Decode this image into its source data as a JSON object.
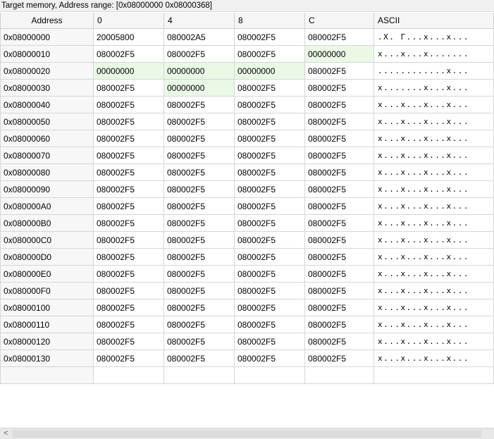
{
  "title": "Target memory, Address range: [0x08000000 0x08000368]",
  "columns": [
    "Address",
    "0",
    "4",
    "8",
    "C",
    "ASCII"
  ],
  "zero_cell_color": "#e9f9e6",
  "rows": [
    {
      "address": "0x08000000",
      "c0": "20005800",
      "c4": "080002A5",
      "c8": "080002F5",
      "cc": "080002F5",
      "ascii": ".X. Г...х...х...",
      "zero": []
    },
    {
      "address": "0x08000010",
      "c0": "080002F5",
      "c4": "080002F5",
      "c8": "080002F5",
      "cc": "00000000",
      "ascii": "х...х...х.......",
      "zero": [
        "cc"
      ]
    },
    {
      "address": "0x08000020",
      "c0": "00000000",
      "c4": "00000000",
      "c8": "00000000",
      "cc": "080002F5",
      "ascii": "............х...",
      "zero": [
        "c0",
        "c4",
        "c8"
      ]
    },
    {
      "address": "0x08000030",
      "c0": "080002F5",
      "c4": "00000000",
      "c8": "080002F5",
      "cc": "080002F5",
      "ascii": "х.......х...х...",
      "zero": [
        "c4"
      ]
    },
    {
      "address": "0x08000040",
      "c0": "080002F5",
      "c4": "080002F5",
      "c8": "080002F5",
      "cc": "080002F5",
      "ascii": "х...х...х...х...",
      "zero": []
    },
    {
      "address": "0x08000050",
      "c0": "080002F5",
      "c4": "080002F5",
      "c8": "080002F5",
      "cc": "080002F5",
      "ascii": "х...х...х...х...",
      "zero": []
    },
    {
      "address": "0x08000060",
      "c0": "080002F5",
      "c4": "080002F5",
      "c8": "080002F5",
      "cc": "080002F5",
      "ascii": "х...х...х...х...",
      "zero": []
    },
    {
      "address": "0x08000070",
      "c0": "080002F5",
      "c4": "080002F5",
      "c8": "080002F5",
      "cc": "080002F5",
      "ascii": "х...х...х...х...",
      "zero": []
    },
    {
      "address": "0x08000080",
      "c0": "080002F5",
      "c4": "080002F5",
      "c8": "080002F5",
      "cc": "080002F5",
      "ascii": "х...х...х...х...",
      "zero": []
    },
    {
      "address": "0x08000090",
      "c0": "080002F5",
      "c4": "080002F5",
      "c8": "080002F5",
      "cc": "080002F5",
      "ascii": "х...х...х...х...",
      "zero": []
    },
    {
      "address": "0x080000A0",
      "c0": "080002F5",
      "c4": "080002F5",
      "c8": "080002F5",
      "cc": "080002F5",
      "ascii": "х...х...х...х...",
      "zero": []
    },
    {
      "address": "0x080000B0",
      "c0": "080002F5",
      "c4": "080002F5",
      "c8": "080002F5",
      "cc": "080002F5",
      "ascii": "х...х...х...х...",
      "zero": []
    },
    {
      "address": "0x080000C0",
      "c0": "080002F5",
      "c4": "080002F5",
      "c8": "080002F5",
      "cc": "080002F5",
      "ascii": "х...х...х...х...",
      "zero": []
    },
    {
      "address": "0x080000D0",
      "c0": "080002F5",
      "c4": "080002F5",
      "c8": "080002F5",
      "cc": "080002F5",
      "ascii": "х...х...х...х...",
      "zero": []
    },
    {
      "address": "0x080000E0",
      "c0": "080002F5",
      "c4": "080002F5",
      "c8": "080002F5",
      "cc": "080002F5",
      "ascii": "х...х...х...х...",
      "zero": []
    },
    {
      "address": "0x080000F0",
      "c0": "080002F5",
      "c4": "080002F5",
      "c8": "080002F5",
      "cc": "080002F5",
      "ascii": "х...х...х...х...",
      "zero": []
    },
    {
      "address": "0x08000100",
      "c0": "080002F5",
      "c4": "080002F5",
      "c8": "080002F5",
      "cc": "080002F5",
      "ascii": "х...х...х...х...",
      "zero": []
    },
    {
      "address": "0x08000110",
      "c0": "080002F5",
      "c4": "080002F5",
      "c8": "080002F5",
      "cc": "080002F5",
      "ascii": "х...х...х...х...",
      "zero": []
    },
    {
      "address": "0x08000120",
      "c0": "080002F5",
      "c4": "080002F5",
      "c8": "080002F5",
      "cc": "080002F5",
      "ascii": "х...х...х...х...",
      "zero": []
    },
    {
      "address": "0x08000130",
      "c0": "080002F5",
      "c4": "080002F5",
      "c8": "080002F5",
      "cc": "080002F5",
      "ascii": "х...х...х...х...",
      "zero": []
    }
  ],
  "scrollbar": {
    "left_arrow": "<"
  }
}
